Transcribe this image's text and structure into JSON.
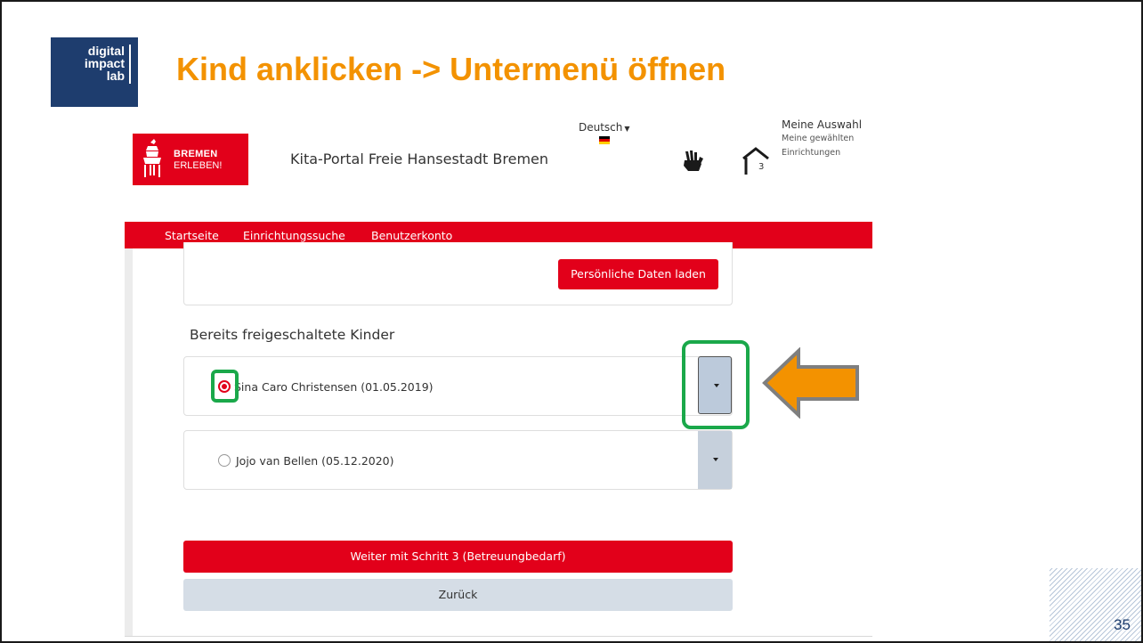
{
  "slide": {
    "logo_lines": [
      "digital",
      "impact",
      "lab"
    ],
    "title": "Kind anklicken -> Untermenü öffnen",
    "page_number": "35"
  },
  "portal": {
    "brand": {
      "line1": "BREMEN",
      "line2": "ERLEBEN!"
    },
    "title": "Kita-Portal Freie Hansestadt Bremen",
    "language": {
      "selected": "Deutsch"
    },
    "selection": {
      "title": "Meine Auswahl",
      "count": "3",
      "subtitle": "Meine gewählten Einrichtungen"
    },
    "nav": {
      "items": [
        {
          "label": "Startseite"
        },
        {
          "label": "Einrichtungssuche"
        },
        {
          "label": "Benutzerkonto"
        }
      ]
    },
    "load_button": "Persönliche Daten laden",
    "section_heading": "Bereits freigeschaltete Kinder",
    "children": [
      {
        "label": "Sina Caro Christensen (01.05.2019)",
        "selected": true
      },
      {
        "label": "Jojo van Bellen (05.12.2020)",
        "selected": false
      }
    ],
    "next_button": "Weiter mit Schritt 3 (Betreuungbedarf)",
    "back_button": "Zurück"
  },
  "colors": {
    "slide_title": "#f39200",
    "logo_background": "#1e3d6e",
    "brand_red": "#e2001a",
    "highlight_green": "#1aa84a",
    "arrow_orange": "#f39200",
    "dropdown_gray": "#c6d0dc"
  },
  "icons": {
    "brand": "town-musicians-icon",
    "flag": "german-flag-icon",
    "language_caret": "caret-down-icon",
    "sign_language": "sign-language-icon",
    "home": "house-icon",
    "dropdown": "caret-down-icon",
    "annotation": "arrow-left-icon"
  }
}
